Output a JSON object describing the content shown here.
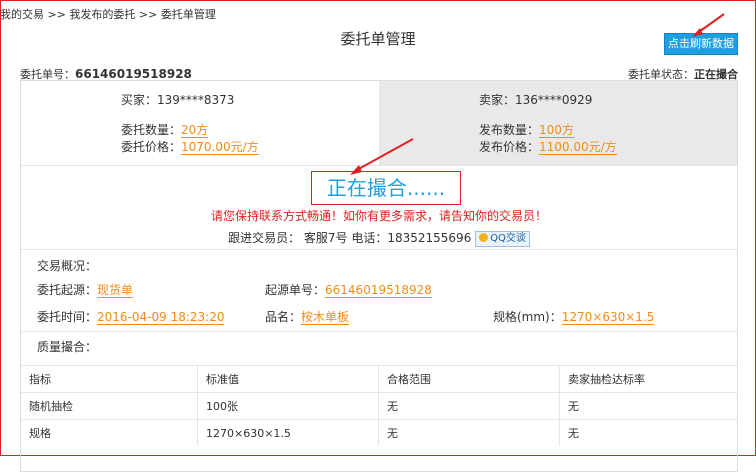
{
  "breadcrumb": "我的交易 >> 我发布的委托 >> 委托单管理",
  "title": "委托单管理",
  "refresh_button": "点击刷新数据",
  "order": {
    "no_label": "委托单号：",
    "no_value": "66146019518928",
    "status_label": "委托单状态：",
    "status_value": "正在撮合"
  },
  "buyer": {
    "label": "买家：139****8373",
    "qty_label": "委托数量：",
    "qty_value": "20方",
    "price_label": "委托价格：",
    "price_value": "1070.00元/方"
  },
  "seller": {
    "label": "卖家：136****0929",
    "qty_label": "发布数量：",
    "qty_value": "100方",
    "price_label": "发布价格：",
    "price_value": "1100.00元/方"
  },
  "matching_text": "正在撮合......",
  "warning": "请您保持联系方式畅通！如你有更多需求，请告知你的交易员！",
  "follow": {
    "text": "跟进交易员： 客服7号 电话：18352155696",
    "qq": "QQ交谈"
  },
  "overview": {
    "title": "交易概况：",
    "source_label": "委托起源：",
    "source_value": "现货单",
    "source_no_label": "起源单号：",
    "source_no_value": "66146019518928",
    "time_label": "委托时间：",
    "time_value": "2016-04-09 18:23:20",
    "product_label": "品名：",
    "product_value": "桉木单板",
    "spec_label": "规格(mm)：",
    "spec_value": "1270×630×1.5"
  },
  "quality": {
    "title": "质量撮合：",
    "headers": [
      "指标",
      "标准值",
      "合格范围",
      "卖家抽检达标率"
    ],
    "rows": [
      [
        "随机抽检",
        "100张",
        "无",
        "无"
      ],
      [
        "规格",
        "1270×630×1.5",
        "无",
        "无"
      ]
    ]
  }
}
